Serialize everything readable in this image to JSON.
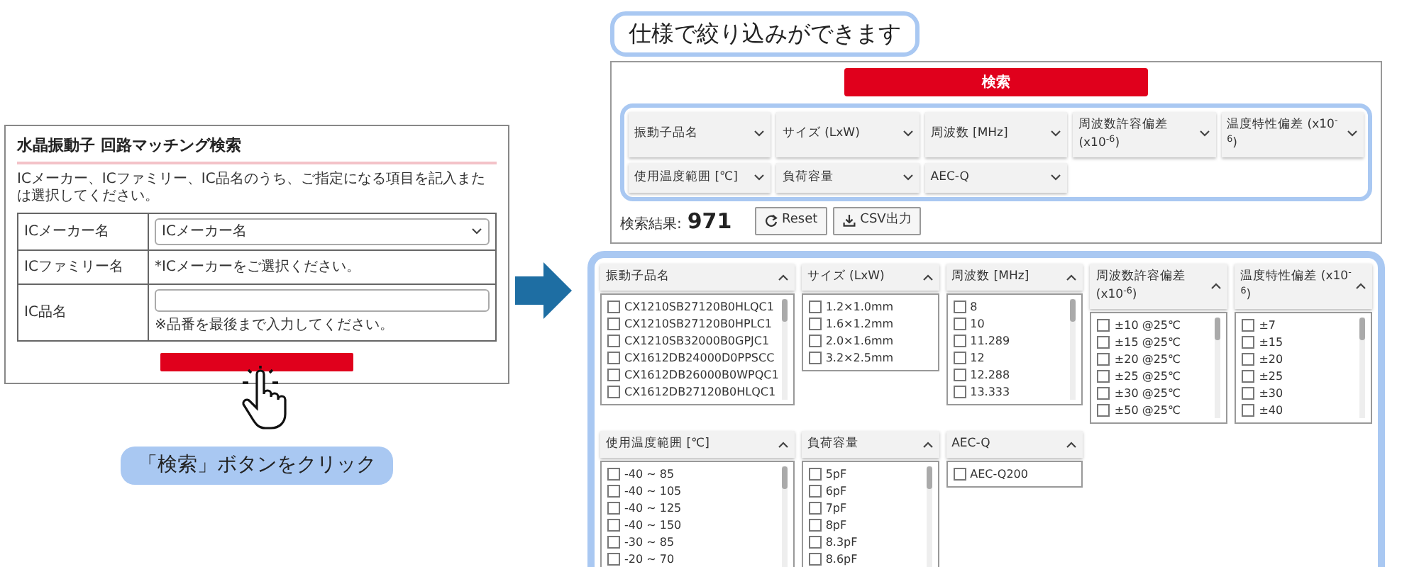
{
  "left_screen": {
    "title": "水晶振動子 回路マッチング検索",
    "description": "ICメーカー、ICファミリー、IC品名のうち、ご指定になる項目を記入または選択してください。",
    "form_rows": [
      {
        "label": "ICメーカー名",
        "kind": "select",
        "value": "ICメーカー名"
      },
      {
        "label": "ICファミリー名",
        "kind": "text",
        "value": "*ICメーカーをご選択ください。"
      },
      {
        "label": "IC品名",
        "kind": "input",
        "hint": "※品番を最後まで入力してください。"
      }
    ]
  },
  "caption": "「検索」ボタンをクリック",
  "callout": "仕様で絞り込みができます",
  "search_button": "検索",
  "filters": [
    "振動子品名",
    "サイズ (LxW)",
    "周波数 [MHz]",
    "周波数許容偏差 (x10$^{-6}$)",
    "温度特性偏差 (x10$^{-6}$)",
    "使用温度範囲 [℃]",
    "負荷容量",
    "AEC-Q"
  ],
  "result_label": "検索結果:",
  "result_count": "971",
  "buttons": [
    {
      "label": "Reset",
      "kind": "reset"
    },
    {
      "label": "CSV出力",
      "kind": "download"
    }
  ],
  "panels": [
    {
      "title": "振動子品名",
      "options": [
        {
          "label": "CX1210SB27120B0HLQC1",
          "checked": false
        },
        {
          "label": "CX1210SB27120B0HPLC1",
          "checked": false
        },
        {
          "label": "CX1210SB32000B0GPJC1",
          "checked": false
        },
        {
          "label": "CX1612DB24000D0PPSCC",
          "checked": false
        },
        {
          "label": "CX1612DB26000B0WPQC1",
          "checked": false
        },
        {
          "label": "CX1612DB27120B0HLQC1",
          "checked": false
        }
      ]
    },
    {
      "title": "サイズ (LxW)",
      "options": [
        {
          "label": "1.2×1.0mm",
          "checked": false
        },
        {
          "label": "1.6×1.2mm",
          "checked": false
        },
        {
          "label": "2.0×1.6mm",
          "checked": false
        },
        {
          "label": "3.2×2.5mm",
          "checked": false
        }
      ]
    },
    {
      "title": "周波数 [MHz]",
      "options": [
        {
          "label": "8",
          "checked": false
        },
        {
          "label": "10",
          "checked": false
        },
        {
          "label": "11.289",
          "checked": false
        },
        {
          "label": "12",
          "checked": false
        },
        {
          "label": "12.288",
          "checked": false
        },
        {
          "label": "13.333",
          "checked": false
        }
      ]
    },
    {
      "title": "周波数許容偏差 (x10$^{-6}$)",
      "options": [
        {
          "label": "±10 @25℃",
          "checked": false
        },
        {
          "label": "±15 @25℃",
          "checked": false
        },
        {
          "label": "±20 @25℃",
          "checked": false
        },
        {
          "label": "±25 @25℃",
          "checked": false
        },
        {
          "label": "±30 @25℃",
          "checked": false
        },
        {
          "label": "±50 @25℃",
          "checked": false
        }
      ]
    },
    {
      "title": "温度特性偏差 (x10$^{-6}$)",
      "options": [
        {
          "label": "±7",
          "checked": false
        },
        {
          "label": "±15",
          "checked": false
        },
        {
          "label": "±20",
          "checked": false
        },
        {
          "label": "±25",
          "checked": false
        },
        {
          "label": "±30",
          "checked": false
        },
        {
          "label": "±40",
          "checked": false
        }
      ]
    },
    {
      "title": "使用温度範囲 [℃]",
      "options": [
        {
          "label": "-40 ~ 85",
          "checked": false
        },
        {
          "label": "-40 ~ 105",
          "checked": false
        },
        {
          "label": "-40 ~ 125",
          "checked": false
        },
        {
          "label": "-40 ~ 150",
          "checked": false
        },
        {
          "label": "-30 ~ 85",
          "checked": false
        },
        {
          "label": "-20 ~ 70",
          "checked": false
        }
      ]
    },
    {
      "title": "負荷容量",
      "options": [
        {
          "label": "5pF",
          "checked": false
        },
        {
          "label": "6pF",
          "checked": false
        },
        {
          "label": "7pF",
          "checked": false
        },
        {
          "label": "8pF",
          "checked": false
        },
        {
          "label": "8.3pF",
          "checked": false
        },
        {
          "label": "8.6pF",
          "checked": false
        }
      ]
    },
    {
      "title": "AEC-Q",
      "options": [
        {
          "label": "AEC-Q200",
          "checked": false
        }
      ]
    }
  ]
}
